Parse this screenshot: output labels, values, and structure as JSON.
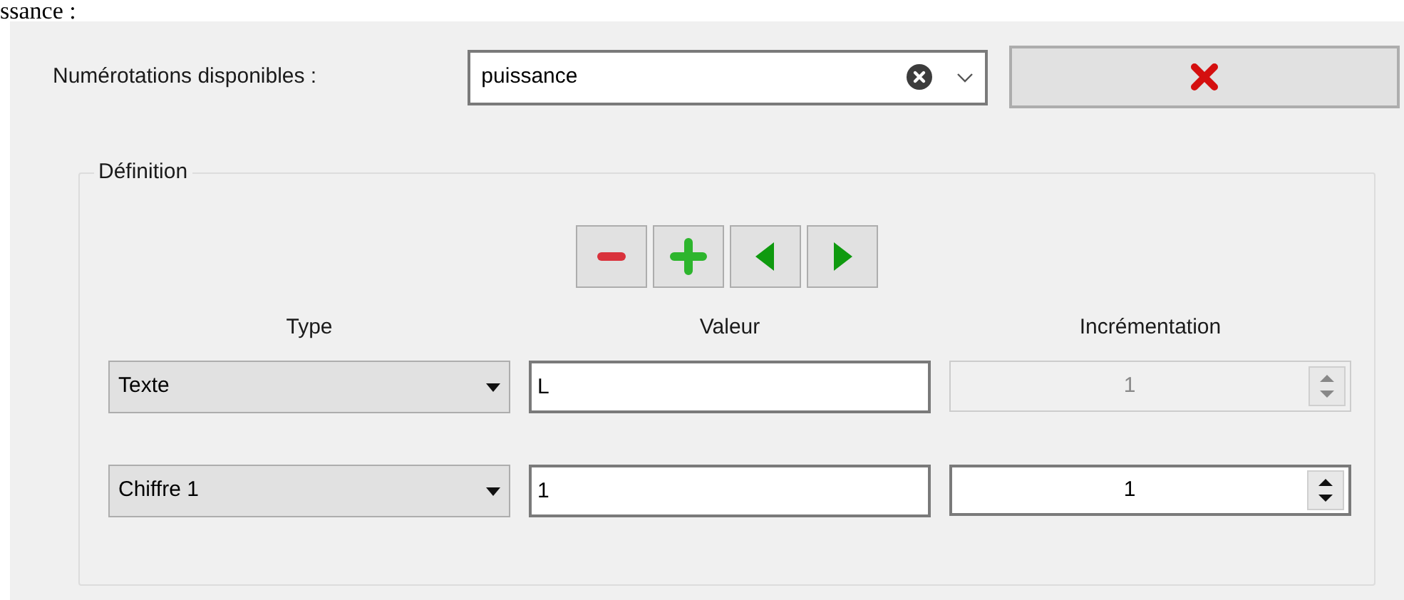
{
  "heading_fragment": "ssance :",
  "numbering": {
    "label": "Numérotations disponibles :",
    "value": "puissance"
  },
  "definition": {
    "title": "Définition",
    "columns": [
      "Type",
      "Valeur",
      "Incrémentation"
    ],
    "rows": [
      {
        "type": "Texte",
        "value": "L",
        "increment": "1",
        "increment_disabled": true
      },
      {
        "type": "Chiffre 1",
        "value": "1",
        "increment": "1",
        "increment_disabled": false
      }
    ]
  }
}
